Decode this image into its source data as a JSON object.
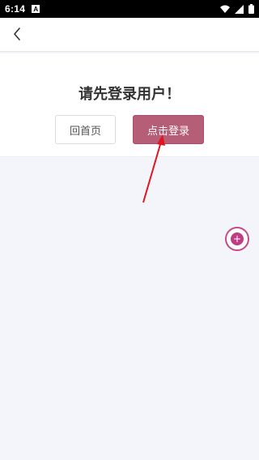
{
  "status_bar": {
    "time": "6:14",
    "notification_icon": "a-icon",
    "right_icons": [
      "wifi-icon",
      "signal-icon",
      "battery-icon"
    ]
  },
  "nav": {
    "back_icon": "chevron-left-icon"
  },
  "main": {
    "prompt": "请先登录用户！",
    "home_button_label": "回首页",
    "login_button_label": "点击登录"
  },
  "annotation": {
    "arrow_color": "#e1151f"
  },
  "floating_button": {
    "icon": "plus-icon",
    "symbol": "+"
  },
  "colors": {
    "accent": "#b65d78",
    "fab_ring": "#c44a8a",
    "background": "#f4f5fa"
  }
}
